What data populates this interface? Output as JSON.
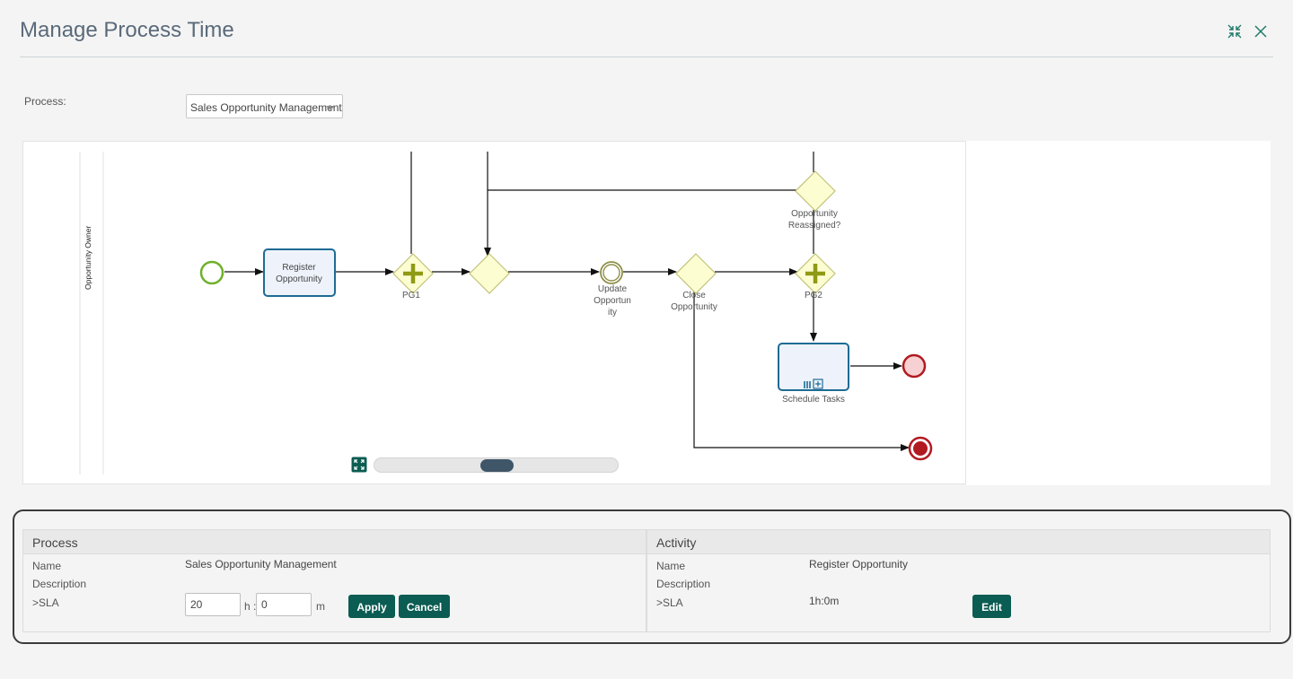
{
  "dialog": {
    "title": "Manage Process Time",
    "collapse_icon": "collapse-arrows-icon",
    "close_icon": "close-icon"
  },
  "process_selector": {
    "label": "Process:",
    "selected": "Sales Opportunity Management"
  },
  "diagram": {
    "lane_label": "Opportunity Owner",
    "nodes": {
      "register_opportunity": "Register Opportunity",
      "pg1": "PG1",
      "update_opportunity_lines": [
        "Update",
        "Opportun",
        "ity"
      ],
      "close_opportunity_lines": [
        "Close",
        "Opportunity"
      ],
      "opportunity_reassigned_lines": [
        "Opportunity",
        "Reassigned?"
      ],
      "pg2": "PG2",
      "schedule_tasks": "Schedule Tasks"
    },
    "colors": {
      "start_event": "#6fb02a",
      "end_event": "#b11a20",
      "task_border": "#1e6b94",
      "gateway_fill": "#fdfdd2",
      "gateway_marker": "#8f9a15",
      "accent": "#0b5c52"
    }
  },
  "process_panel": {
    "header": "Process",
    "name_label": "Name",
    "name_value": "Sales Opportunity Management",
    "description_label": "Description",
    "sla_label": ">SLA",
    "hours_value": "20",
    "hours_unit": "h :",
    "minutes_value": "0",
    "minutes_unit": "m",
    "apply_label": "Apply",
    "cancel_label": "Cancel"
  },
  "activity_panel": {
    "header": "Activity",
    "name_label": "Name",
    "name_value": "Register Opportunity",
    "description_label": "Description",
    "sla_label": ">SLA",
    "sla_value": "1h:0m",
    "edit_label": "Edit"
  }
}
